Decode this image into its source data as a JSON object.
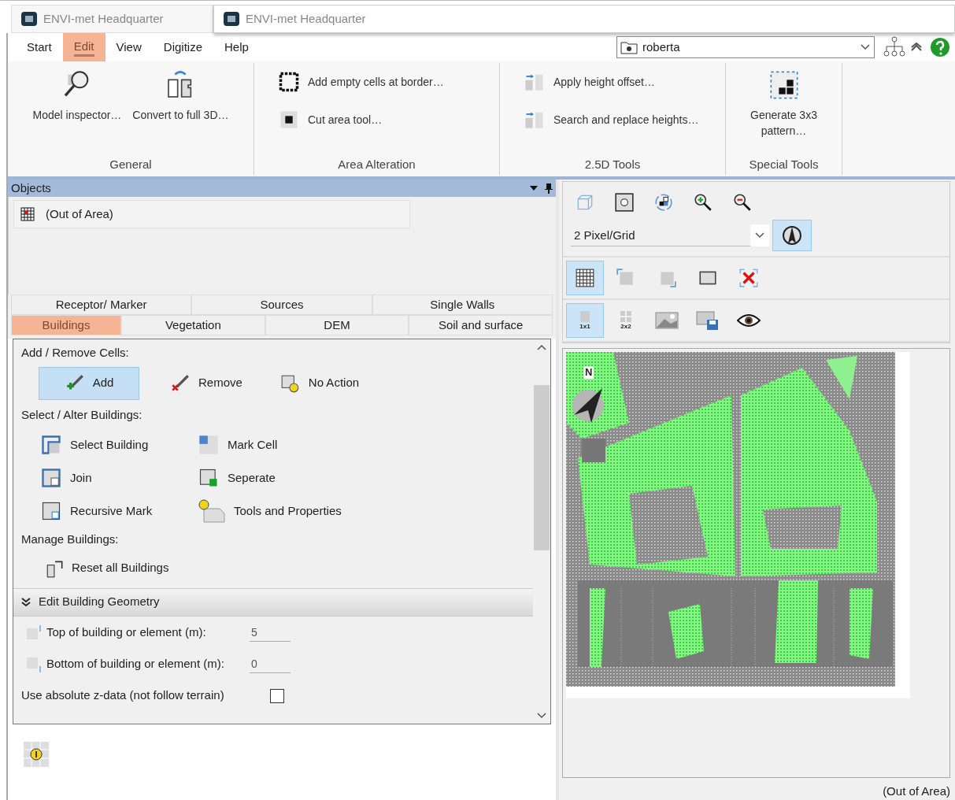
{
  "window_tabs": [
    {
      "title": "ENVI-met Headquarter",
      "selected": false
    },
    {
      "title": "ENVI-met Headquarter",
      "selected": true
    }
  ],
  "menu": [
    {
      "label": "Start",
      "selected": false
    },
    {
      "label": "Edit",
      "selected": true
    },
    {
      "label": "View",
      "selected": false
    },
    {
      "label": "Digitize",
      "selected": false
    },
    {
      "label": "Help",
      "selected": false
    }
  ],
  "project": {
    "value": "roberta"
  },
  "ribbon": {
    "groups": [
      {
        "label": "General",
        "kind": "large",
        "items": [
          {
            "label": "Model inspector…",
            "kind": "magnifier"
          },
          {
            "label": "Convert to full 3D…",
            "kind": "convert"
          }
        ]
      },
      {
        "label": "Area Alteration",
        "kind": "small",
        "items": [
          {
            "label": "Add empty cells at border…",
            "kind": "border-cells"
          },
          {
            "label": "Cut area tool…",
            "kind": "cut-area"
          }
        ]
      },
      {
        "label": "2.5D Tools",
        "kind": "small",
        "items": [
          {
            "label": "Apply height offset…",
            "kind": "height"
          },
          {
            "label": "Search and replace heights…",
            "kind": "height"
          }
        ]
      },
      {
        "label": "Special Tools",
        "kind": "large",
        "items": [
          {
            "label": "Generate 3x3 pattern…",
            "kind": "pattern"
          }
        ]
      }
    ]
  },
  "objects": {
    "title": "Objects",
    "items": [
      {
        "label": "(Out of Area)"
      }
    ]
  },
  "object_tabs": [
    [
      {
        "label": "Receptor/ Marker",
        "selected": false
      },
      {
        "label": "Sources",
        "selected": false
      },
      {
        "label": "Single Walls",
        "selected": false
      }
    ],
    [
      {
        "label": "Buildings",
        "selected": true
      },
      {
        "label": "Vegetation",
        "selected": false
      },
      {
        "label": "DEM",
        "selected": false
      },
      {
        "label": "Soil and surface",
        "selected": false
      }
    ]
  ],
  "buildings_panel": {
    "add_remove": {
      "title": "Add / Remove Cells:",
      "tools": [
        {
          "label": "Add",
          "kind": "add",
          "selected": true
        },
        {
          "label": "Remove",
          "kind": "remove",
          "selected": false
        },
        {
          "label": "No Action",
          "kind": "no-action",
          "selected": false
        }
      ]
    },
    "select_alter": {
      "title": "Select / Alter Buildings:",
      "tools": [
        {
          "label": "Select Building",
          "kind": "select-building"
        },
        {
          "label": "Mark Cell",
          "kind": "mark-cell"
        },
        {
          "label": "Join",
          "kind": "join"
        },
        {
          "label": "Seperate",
          "kind": "separate"
        },
        {
          "label": "Recursive Mark",
          "kind": "recursive"
        },
        {
          "label": "Tools and Properties",
          "kind": "tools"
        }
      ]
    },
    "manage": {
      "title": "Manage Buildings:",
      "tools": [
        {
          "label": "Reset all Buildings",
          "kind": "reset"
        }
      ]
    },
    "geometry": {
      "title": "Edit Building Geometry",
      "expanded": true,
      "fields": [
        {
          "label": "Top of building or element (m):",
          "value": "5",
          "kind": "top"
        },
        {
          "label": "Bottom of building or element (m):",
          "value": "0",
          "kind": "bottom"
        }
      ],
      "checkbox": {
        "label": "Use absolute z-data (not follow terrain)",
        "checked": false
      }
    }
  },
  "view_toolbar": {
    "rows": [
      [
        {
          "kind": "cube",
          "selected": false
        },
        {
          "kind": "info-frame",
          "selected": false
        },
        {
          "kind": "rotate",
          "selected": false
        },
        {
          "kind": "zoom-in",
          "selected": false
        },
        {
          "kind": "zoom-out",
          "selected": false
        }
      ],
      [
        {
          "kind": "grid",
          "selected": true
        },
        {
          "kind": "select-left",
          "selected": false
        },
        {
          "kind": "select-right",
          "selected": false
        },
        {
          "kind": "frame",
          "selected": false
        },
        {
          "kind": "clear",
          "selected": false
        }
      ],
      [
        {
          "kind": "cell-1x1",
          "label": "1x1",
          "selected": true
        },
        {
          "kind": "cell-2x2",
          "label": "2x2",
          "selected": false
        },
        {
          "kind": "image",
          "selected": false
        },
        {
          "kind": "save-image",
          "selected": false
        },
        {
          "kind": "eye",
          "selected": false
        }
      ]
    ],
    "zoom": {
      "value": "2 Pixel/Grid"
    },
    "north_button": {
      "selected": true
    }
  },
  "map": {
    "north_label": "N"
  },
  "status_bar": {
    "text": "(Out of Area)"
  }
}
